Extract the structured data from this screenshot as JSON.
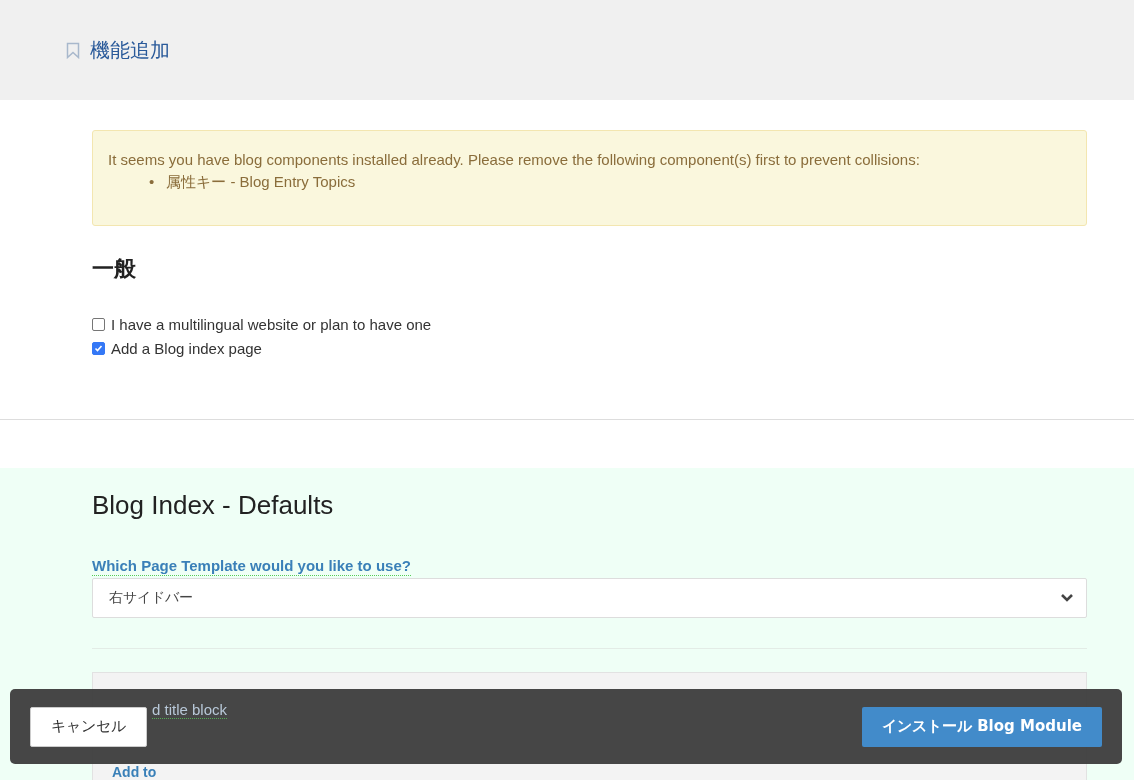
{
  "header": {
    "title": "機能追加"
  },
  "alert": {
    "message": "It seems you have blog components installed already. Please remove the following component(s) first to prevent collisions:",
    "bullet": "•",
    "items": [
      "属性キー - Blog Entry Topics"
    ]
  },
  "general": {
    "heading": "一般",
    "options": [
      {
        "label": "I have a multilingual website or plan to have one",
        "checked": false
      },
      {
        "label": "Add a Blog index page",
        "checked": true
      }
    ]
  },
  "blog_index": {
    "heading": "Blog Index - Defaults",
    "template_label": "Which Page Template would you like to use?",
    "template_value": "右サイドバー",
    "panel": {
      "field_label": "d title block",
      "next_label": "Add to"
    }
  },
  "footer": {
    "cancel": "キャンセル",
    "install": "インストール Blog Module"
  }
}
